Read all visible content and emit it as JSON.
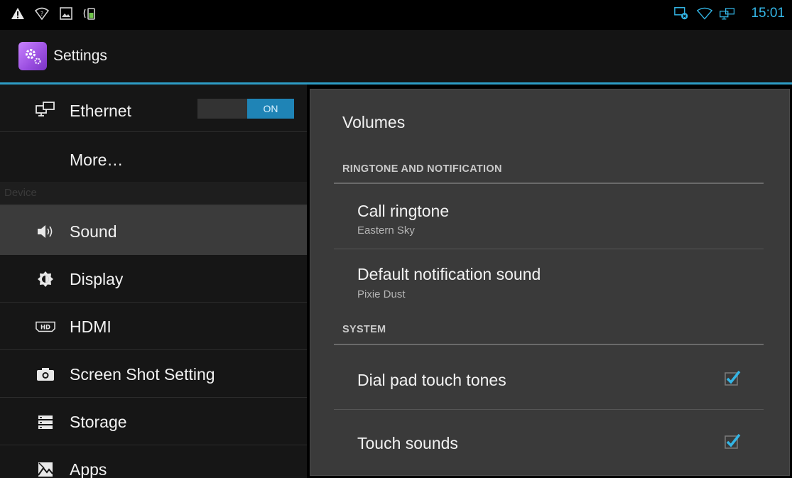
{
  "status_bar": {
    "time": "15:01",
    "left_icons": [
      "warning-icon",
      "wifi-question-icon",
      "image-icon",
      "charging-icon"
    ],
    "right_icons": [
      "screen-cast-icon",
      "wifi-icon",
      "ethernet-icon"
    ],
    "accent_color": "#33b5e5"
  },
  "action_bar": {
    "title": "Settings",
    "icon": "settings-gear-icon"
  },
  "sidebar": {
    "items": [
      {
        "label": "Ethernet",
        "icon": "ethernet-icon",
        "toggle": "ON"
      },
      {
        "label": "More…"
      },
      {
        "category": "Device"
      },
      {
        "label": "Sound",
        "icon": "speaker-icon",
        "selected": true
      },
      {
        "label": "Display",
        "icon": "brightness-icon"
      },
      {
        "label": "HDMI",
        "icon": "hdmi-icon"
      },
      {
        "label": "Screen Shot Setting",
        "icon": "camera-icon"
      },
      {
        "label": "Storage",
        "icon": "storage-icon"
      },
      {
        "label": "Apps",
        "icon": "apps-icon"
      }
    ]
  },
  "detail": {
    "volumes": "Volumes",
    "sections": [
      {
        "header": "RINGTONE AND NOTIFICATION",
        "prefs": [
          {
            "title": "Call ringtone",
            "summary": "Eastern Sky"
          },
          {
            "title": "Default notification sound",
            "summary": "Pixie Dust"
          }
        ]
      },
      {
        "header": "SYSTEM",
        "prefs": [
          {
            "title": "Dial pad touch tones",
            "checked": true
          },
          {
            "title": "Touch sounds",
            "checked": true
          }
        ]
      }
    ]
  }
}
